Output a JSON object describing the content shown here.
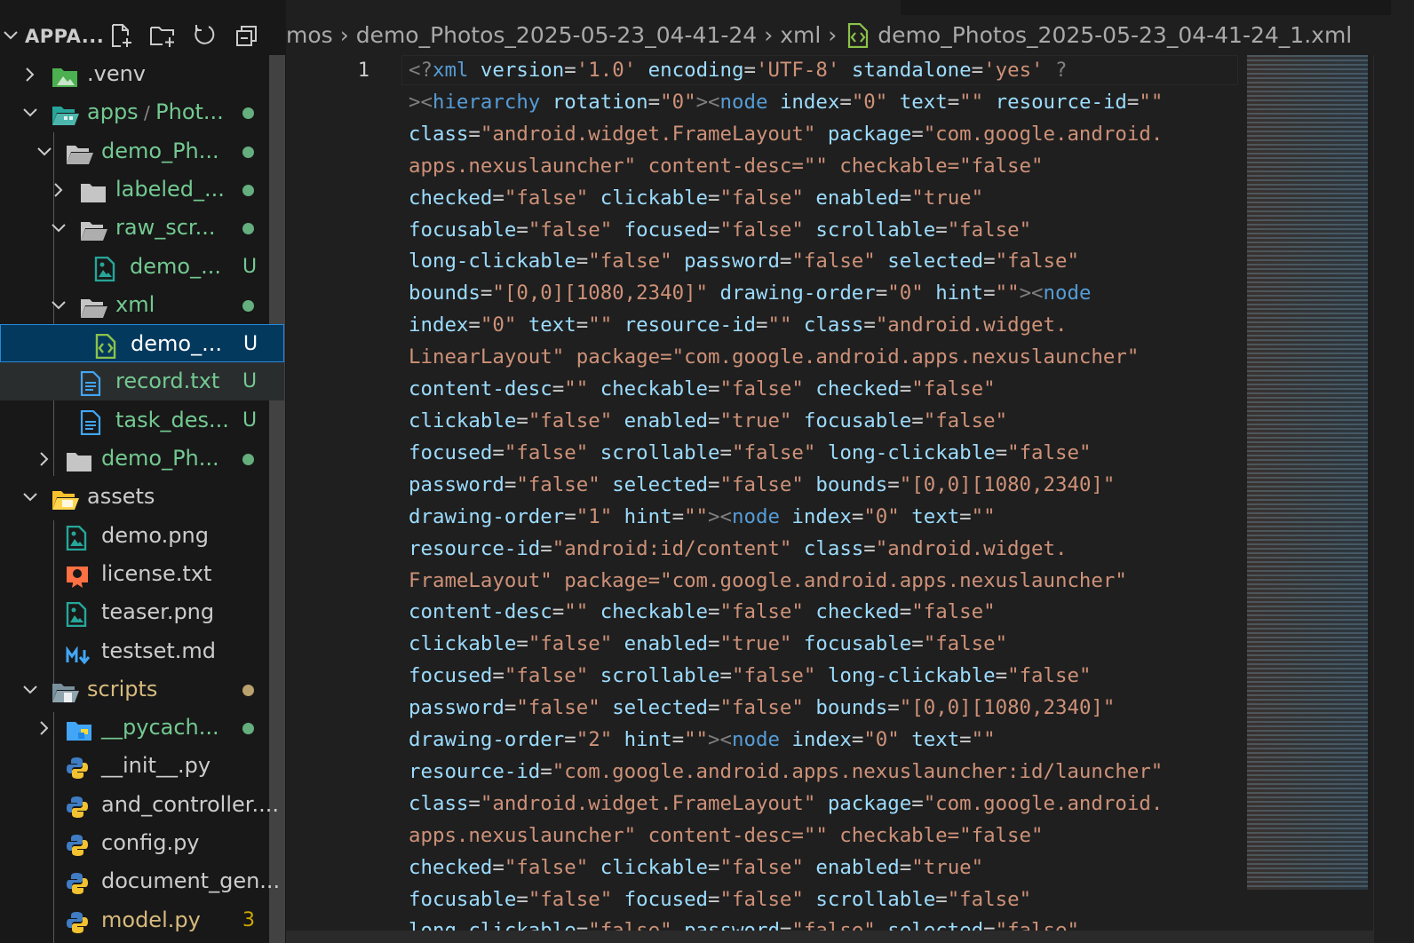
{
  "explorer": {
    "title": "APPA...",
    "actions": [
      "new-file",
      "new-folder",
      "refresh",
      "collapse-all"
    ]
  },
  "tree": [
    {
      "label": ".venv",
      "kind": "folder-venv",
      "depth": 1,
      "expanded": false,
      "chevron": true,
      "status": ""
    },
    {
      "label": "apps",
      "label2": "Phot...",
      "kind": "folder-apps",
      "depth": 1,
      "expanded": true,
      "chevron": true,
      "status": "dot"
    },
    {
      "label": "demo_Ph...",
      "kind": "folder",
      "depth": 2,
      "expanded": true,
      "chevron": true,
      "status": "dot"
    },
    {
      "label": "labeled_...",
      "kind": "folder",
      "depth": 3,
      "expanded": false,
      "chevron": true,
      "status": "dot"
    },
    {
      "label": "raw_scr...",
      "kind": "folder",
      "depth": 3,
      "expanded": true,
      "chevron": true,
      "status": "dot"
    },
    {
      "label": "demo_...",
      "kind": "image",
      "depth": 4,
      "chevron": false,
      "status": "U"
    },
    {
      "label": "xml",
      "kind": "folder",
      "depth": 3,
      "expanded": true,
      "chevron": true,
      "status": "dot"
    },
    {
      "label": "demo_...",
      "kind": "xml",
      "depth": 4,
      "chevron": false,
      "status": "U",
      "selected": true
    },
    {
      "label": "record.txt",
      "kind": "text",
      "depth": 3,
      "chevron": false,
      "status": "U",
      "hover": true
    },
    {
      "label": "task_des...",
      "kind": "text",
      "depth": 3,
      "chevron": false,
      "status": "U"
    },
    {
      "label": "demo_Ph...",
      "kind": "folder",
      "depth": 2,
      "expanded": false,
      "chevron": true,
      "status": "dot"
    },
    {
      "label": "assets",
      "kind": "folder-assets",
      "depth": 1,
      "expanded": true,
      "chevron": true,
      "status": ""
    },
    {
      "label": "demo.png",
      "kind": "image",
      "depth": 2,
      "chevron": false,
      "status": ""
    },
    {
      "label": "license.txt",
      "kind": "license",
      "depth": 2,
      "chevron": false,
      "status": ""
    },
    {
      "label": "teaser.png",
      "kind": "image",
      "depth": 2,
      "chevron": false,
      "status": ""
    },
    {
      "label": "testset.md",
      "kind": "markdown",
      "depth": 2,
      "chevron": false,
      "status": ""
    },
    {
      "label": "scripts",
      "kind": "folder-scripts",
      "depth": 1,
      "expanded": true,
      "chevron": true,
      "status": "dot-yellow"
    },
    {
      "label": "__pycach...",
      "kind": "folder-py",
      "depth": 2,
      "expanded": false,
      "chevron": true,
      "status": "dot"
    },
    {
      "label": "__init__.py",
      "kind": "python",
      "depth": 2,
      "chevron": false,
      "status": ""
    },
    {
      "label": "and_controller....",
      "kind": "python",
      "depth": 2,
      "chevron": false,
      "status": ""
    },
    {
      "label": "config.py",
      "kind": "python",
      "depth": 2,
      "chevron": false,
      "status": ""
    },
    {
      "label": "document_gen...",
      "kind": "python",
      "depth": 2,
      "chevron": false,
      "status": ""
    },
    {
      "label": "model.py",
      "kind": "python",
      "depth": 2,
      "chevron": false,
      "status": "3"
    }
  ],
  "breadcrumb": {
    "segments": [
      "mos",
      "demo_Photos_2025-05-23_04-41-24",
      "xml"
    ],
    "file": "demo_Photos_2025-05-23_04-41-24_1.xml"
  },
  "editor": {
    "line_number": "1",
    "lines": [
      "<?xml version='1.0' encoding='UTF-8' standalone='yes' ?",
      "><hierarchy rotation=\"0\"><node index=\"0\" text=\"\" resource-id=\"\"",
      "class=\"android.widget.FrameLayout\" package=\"com.google.android.",
      "apps.nexuslauncher\" content-desc=\"\" checkable=\"false\"",
      "checked=\"false\" clickable=\"false\" enabled=\"true\"",
      "focusable=\"false\" focused=\"false\" scrollable=\"false\"",
      "long-clickable=\"false\" password=\"false\" selected=\"false\"",
      "bounds=\"[0,0][1080,2340]\" drawing-order=\"0\" hint=\"\"><node",
      "index=\"0\" text=\"\" resource-id=\"\" class=\"android.widget.",
      "LinearLayout\" package=\"com.google.android.apps.nexuslauncher\"",
      "content-desc=\"\" checkable=\"false\" checked=\"false\"",
      "clickable=\"false\" enabled=\"true\" focusable=\"false\"",
      "focused=\"false\" scrollable=\"false\" long-clickable=\"false\"",
      "password=\"false\" selected=\"false\" bounds=\"[0,0][1080,2340]\"",
      "drawing-order=\"1\" hint=\"\"><node index=\"0\" text=\"\"",
      "resource-id=\"android:id/content\" class=\"android.widget.",
      "FrameLayout\" package=\"com.google.android.apps.nexuslauncher\"",
      "content-desc=\"\" checkable=\"false\" checked=\"false\"",
      "clickable=\"false\" enabled=\"true\" focusable=\"false\"",
      "focused=\"false\" scrollable=\"false\" long-clickable=\"false\"",
      "password=\"false\" selected=\"false\" bounds=\"[0,0][1080,2340]\"",
      "drawing-order=\"2\" hint=\"\"><node index=\"0\" text=\"\"",
      "resource-id=\"com.google.android.apps.nexuslauncher:id/launcher\"",
      "class=\"android.widget.FrameLayout\" package=\"com.google.android.",
      "apps.nexuslauncher\" content-desc=\"\" checkable=\"false\"",
      "checked=\"false\" clickable=\"false\" enabled=\"true\"",
      "focusable=\"false\" focused=\"false\" scrollable=\"false\"",
      "long-clickable=\"false\" password=\"false\" selected=\"false\""
    ]
  },
  "colors": {
    "git_untracked": "#73c991",
    "git_dot": "#73c991",
    "git_dot_modified": "#d7ba7d",
    "badge_problems": "#cca700",
    "label_default": "#cccccc",
    "selection_bg": "#04395e",
    "xml_tag": "#569cd6",
    "xml_attr": "#9cdcfe",
    "xml_string": "#ce9178"
  }
}
